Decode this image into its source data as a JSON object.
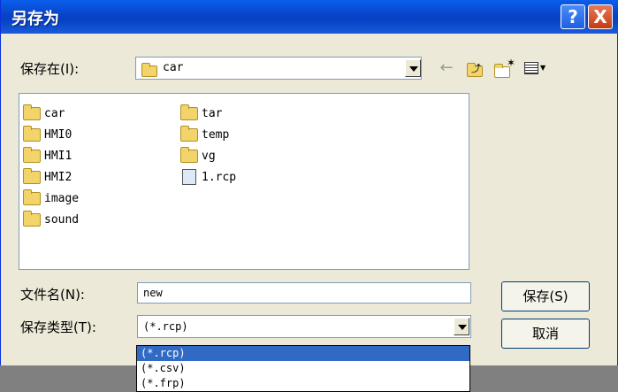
{
  "window": {
    "title": "另存为",
    "help": "?",
    "close": "X"
  },
  "save_in": {
    "label": "保存在(I):",
    "value": "car"
  },
  "files": {
    "col1": [
      {
        "name": "car",
        "type": "folder"
      },
      {
        "name": "HMI0",
        "type": "folder"
      },
      {
        "name": "HMI1",
        "type": "folder"
      },
      {
        "name": "HMI2",
        "type": "folder"
      },
      {
        "name": "image",
        "type": "folder"
      },
      {
        "name": "sound",
        "type": "folder"
      }
    ],
    "col2": [
      {
        "name": "tar",
        "type": "folder"
      },
      {
        "name": "temp",
        "type": "folder"
      },
      {
        "name": "vg",
        "type": "folder"
      },
      {
        "name": "1.rcp",
        "type": "file"
      }
    ]
  },
  "filename": {
    "label": "文件名(N):",
    "value": "new"
  },
  "filetype": {
    "label": "保存类型(T):",
    "value": "(*.rcp)",
    "options": [
      "(*.rcp)",
      "(*.csv)",
      "(*.frp)"
    ]
  },
  "buttons": {
    "save": "保存(S)",
    "cancel": "取消"
  }
}
